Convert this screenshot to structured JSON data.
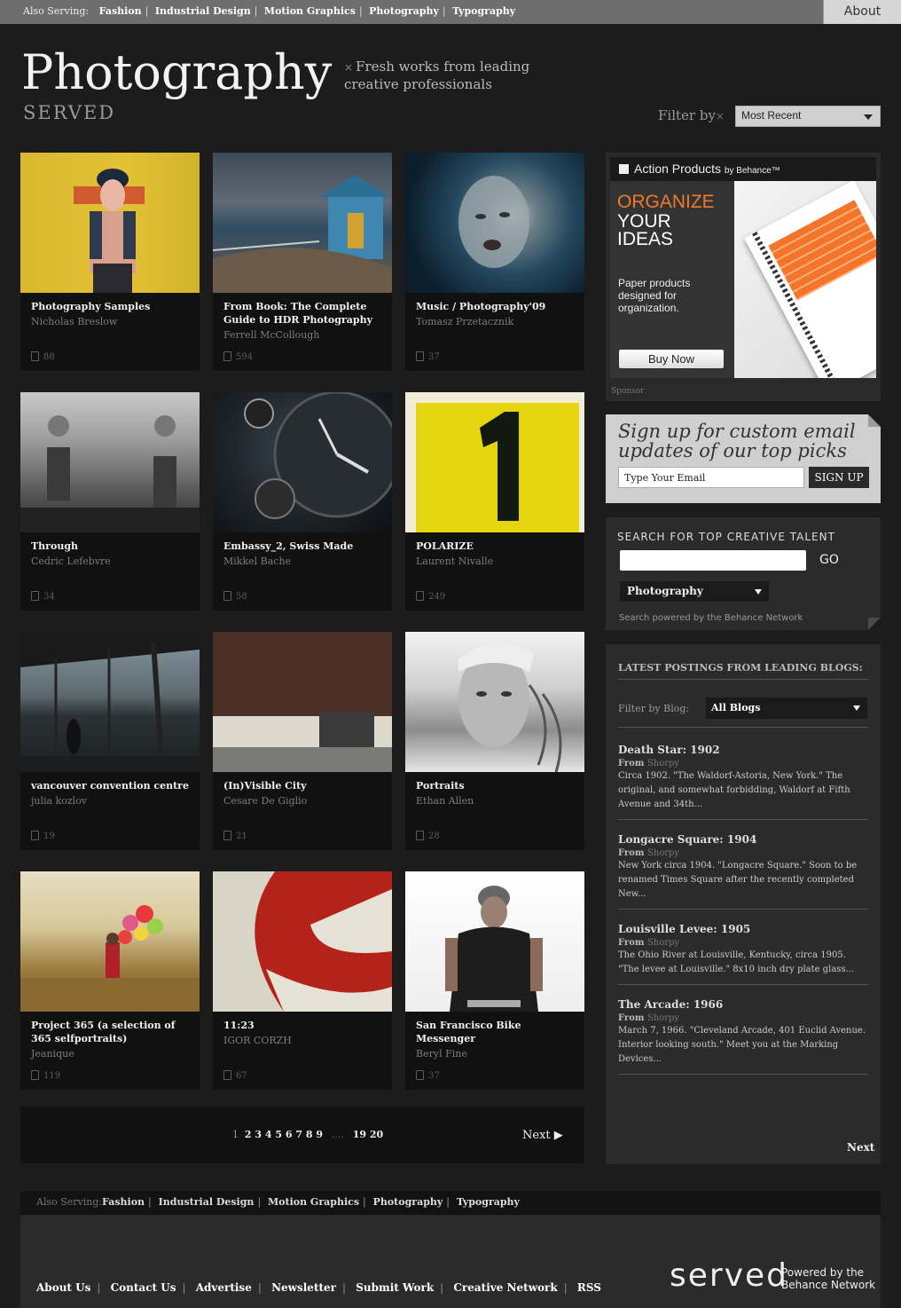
{
  "topbar": {
    "also_label": "Also Serving:",
    "links": [
      "Fashion",
      "Industrial Design",
      "Motion Graphics",
      "Photography",
      "Typography"
    ],
    "about": "About"
  },
  "header": {
    "title": "Photography",
    "subtitle": "SERVED",
    "tagline_x": "×",
    "tagline": "Fresh works from leading creative professionals",
    "filter_label": "Filter by",
    "filter_x": "×",
    "filter_value": "Most Recent"
  },
  "projects": [
    {
      "title": "Photography Samples",
      "author": "Nicholas Breslow",
      "count": "88"
    },
    {
      "title": "From Book: The Complete Guide to HDR Photography",
      "author": "Ferrell McCollough",
      "count": "594"
    },
    {
      "title": "Music / Photography'09",
      "author": "Tomasz Przetacznik",
      "count": "37"
    },
    {
      "title": "Through",
      "author": "Cedric Lefebvre",
      "count": "34"
    },
    {
      "title": "Embassy_2, Swiss Made",
      "author": "Mikkel Bache",
      "count": "58"
    },
    {
      "title": "POLARIZE",
      "author": "Laurent Nivalle",
      "count": "249"
    },
    {
      "title": "vancouver convention centre",
      "author": "julia kozlov",
      "count": "19"
    },
    {
      "title": "(In)Visible City",
      "author": "Cesare De Giglio",
      "count": "21"
    },
    {
      "title": "Portraits",
      "author": "Ethan Allen",
      "count": "28"
    },
    {
      "title": "Project 365 (a selection of 365 selfportraits)",
      "author": "Jeanique",
      "count": "119"
    },
    {
      "title": "11:23",
      "author": "IGOR CORZH",
      "count": "67"
    },
    {
      "title": "San Francisco Bike Messenger",
      "author": "Beryl Fine",
      "count": "37"
    }
  ],
  "pagination": {
    "current": "1",
    "pages": [
      "2",
      "3",
      "4",
      "5",
      "6",
      "7",
      "8",
      "9"
    ],
    "ellipsis": "....",
    "last_pages": [
      "19",
      "20"
    ],
    "next": "Next ▶"
  },
  "ad": {
    "header": "Action Products",
    "header_small": "by Behance™",
    "headline_orange": "ORGANIZE",
    "headline_white": "YOUR IDEAS",
    "body": "Paper products designed for organization.",
    "button": "Buy Now",
    "sponsor": "Sponsor"
  },
  "signup": {
    "heading": "Sign up for custom email updates of our top picks",
    "email_placeholder": "Type Your Email",
    "button": "SIGN UP"
  },
  "search": {
    "heading": "SEARCH FOR TOP CREATIVE TALENT",
    "go": "GO",
    "category": "Photography",
    "powered": "Search powered by the Behance Network"
  },
  "blogs": {
    "heading": "LATEST POSTINGS FROM LEADING BLOGS:",
    "filter_label": "Filter by Blog:",
    "filter_value": "All Blogs",
    "from_label": "From",
    "posts": [
      {
        "title": "Death Star: 1902",
        "source": "Shorpy",
        "excerpt": "Circa 1902. \"The Waldorf-Astoria, New York.\" The original, and somewhat forbidding, Waldorf at Fifth Avenue and 34th..."
      },
      {
        "title": "Longacre Square: 1904",
        "source": "Shorpy",
        "excerpt": "New York circa 1904. \"Longacre Square.\" Soon to be renamed Times Square after the recently completed New..."
      },
      {
        "title": "Louisville Levee: 1905",
        "source": "Shorpy",
        "excerpt": "The Ohio River at Louisville, Kentucky, circa 1905. \"The levee at Louisville.\" 8x10 inch dry plate glass..."
      },
      {
        "title": "The Arcade: 1966",
        "source": "Shorpy",
        "excerpt": "March 7, 1966. \"Cleveland Arcade, 401 Euclid Avenue. Interior looking south.\" Meet you at the Marking Devices..."
      }
    ],
    "next": "Next"
  },
  "footer": {
    "also_label": "Also Serving:",
    "also_links": [
      "Fashion",
      "Industrial Design",
      "Motion Graphics",
      "Photography",
      "Typography"
    ],
    "links": [
      "About Us",
      "Contact Us",
      "Advertise",
      "Newsletter",
      "Submit Work",
      "Creative Network",
      "RSS"
    ],
    "logo": "served",
    "powered": "Powered by the",
    "network": "Behance Network"
  },
  "colors": {
    "background": "#1c1c1c",
    "accent_orange": "#f07a2b",
    "topbar": "#6e6e6e"
  }
}
